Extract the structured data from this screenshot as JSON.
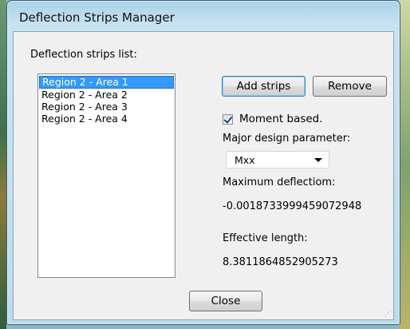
{
  "window": {
    "title": "Deflection Strips Manager"
  },
  "strips": {
    "list_label": "Deflection strips list:",
    "items": [
      "Region 2 - Area 1",
      "Region 2 - Area 2",
      "Region 2 - Area 3",
      "Region 2 - Area 4"
    ],
    "selected_index": 0
  },
  "buttons": {
    "add": "Add strips",
    "remove": "Remove",
    "close": "Close"
  },
  "options": {
    "moment_based_label": "Moment based.",
    "moment_based_checked": true,
    "major_param_label": "Major design parameter:",
    "major_param_value": "Mxx"
  },
  "results": {
    "max_deflection_label": "Maximum deflectiom:",
    "max_deflection_value": "-0.0018733999459072948",
    "effective_length_label": "Effective length:",
    "effective_length_value": "8.3811864852905273"
  }
}
